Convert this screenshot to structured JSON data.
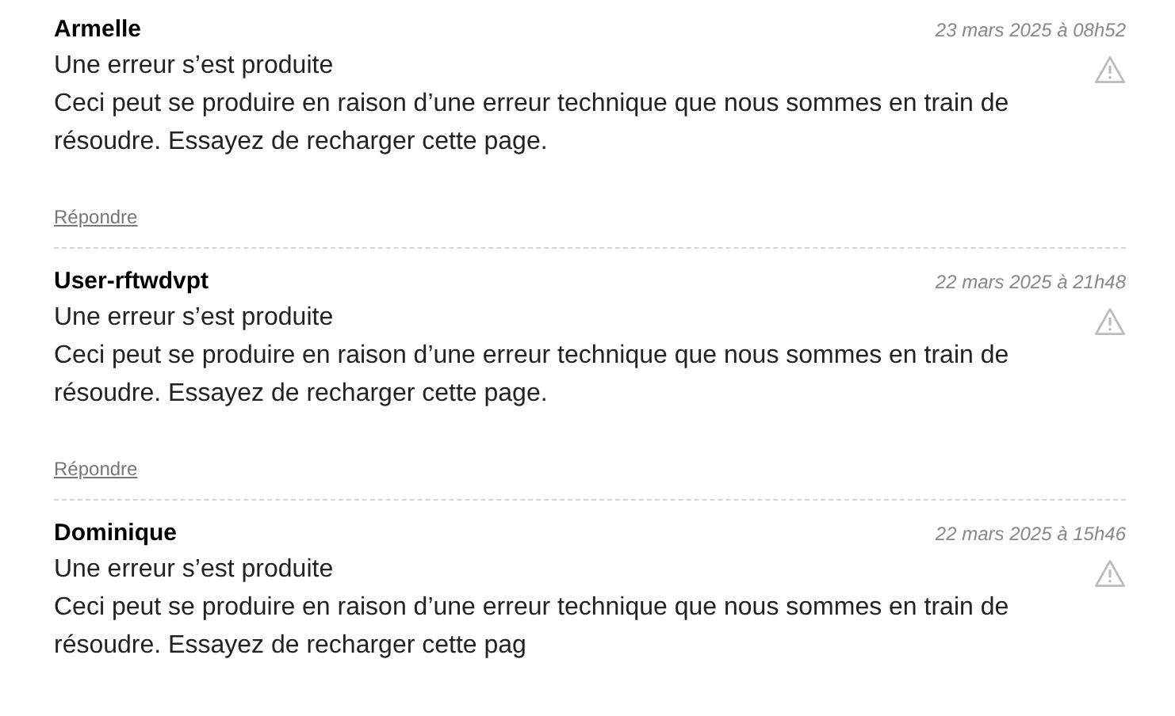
{
  "comments": [
    {
      "author": "Armelle",
      "date": "23 mars 2025 à 08h52",
      "title": "Une erreur s’est produite",
      "body": "Ceci peut se produire en raison d’une erreur technique que nous sommes en train de résoudre. Essayez de recharger cette page.",
      "reply": "Répondre"
    },
    {
      "author": "User-rftwdvpt",
      "date": "22 mars 2025 à 21h48",
      "title": "Une erreur s’est produite",
      "body": "Ceci peut se produire en raison d’une erreur technique que nous sommes en train de résoudre. Essayez de recharger cette page.",
      "reply": "Répondre"
    },
    {
      "author": "Dominique",
      "date": "22 mars 2025 à 15h46",
      "title": "Une erreur s’est produite",
      "body": "Ceci peut se produire en raison d’une erreur technique que nous sommes en train de résoudre. Essayez de recharger cette pag"
    }
  ]
}
